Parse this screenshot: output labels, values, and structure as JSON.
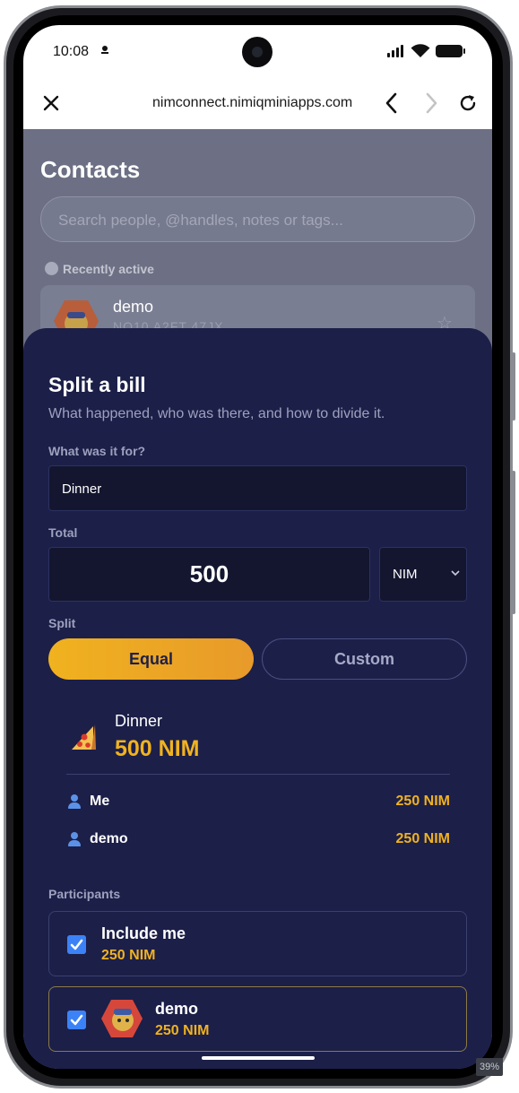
{
  "status_bar": {
    "time": "10:08"
  },
  "browser": {
    "url": "nimconnect.nimiqminiapps.com"
  },
  "contacts": {
    "title": "Contacts",
    "search_placeholder": "Search people, @handles, notes or tags...",
    "recent_label": "Recently active",
    "card": {
      "name": "demo",
      "address": "NQ10 A2FT 47JX"
    }
  },
  "sheet": {
    "title": "Split a bill",
    "subtitle": "What happened, who was there, and how to divide it.",
    "for_label": "What was it for?",
    "for_value": "Dinner",
    "total_label": "Total",
    "total_value": "500",
    "currency": "NIM",
    "split_label": "Split",
    "split_options": [
      "Equal",
      "Custom"
    ],
    "selected_split": "Equal",
    "summary": {
      "label": "Dinner",
      "amount": "500 NIM",
      "icon": "pizza-icon"
    },
    "breakdown": [
      {
        "name": "Me",
        "amount": "250 NIM"
      },
      {
        "name": "demo",
        "amount": "250 NIM"
      }
    ],
    "participants_label": "Participants",
    "participants": [
      {
        "name": "Include me",
        "amount": "250 NIM",
        "checked": true
      },
      {
        "name": "demo",
        "amount": "250 NIM",
        "checked": true
      }
    ]
  },
  "zoom_level": "39%",
  "colors": {
    "accent": "#f0b21f",
    "sheet_bg": "#1c1f48",
    "checkbox": "#3b82f6"
  }
}
